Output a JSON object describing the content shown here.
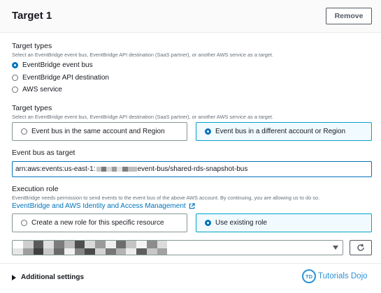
{
  "header": {
    "title": "Target 1",
    "remove_label": "Remove"
  },
  "target_types_1": {
    "label": "Target types",
    "description": "Select an EventBridge event bus, EventBridge API destination (SaaS partner), or another AWS service as a target.",
    "options": [
      {
        "label": "EventBridge event bus",
        "selected": true
      },
      {
        "label": "EventBridge API destination",
        "selected": false
      },
      {
        "label": "AWS service",
        "selected": false
      }
    ]
  },
  "target_types_2": {
    "label": "Target types",
    "description": "Select an EventBridge event bus, EventBridge API destination (SaaS partner), or another AWS service as a target.",
    "options": [
      {
        "label": "Event bus in the same account and Region",
        "selected": false
      },
      {
        "label": "Event bus in a different account or Region",
        "selected": true
      }
    ]
  },
  "event_bus_target": {
    "label": "Event bus as target",
    "value_prefix": "arn:aws:events:us-east-1:",
    "value_suffix": "event-bus/shared-rds-snapshot-bus"
  },
  "execution_role": {
    "label": "Execution role",
    "description": "EventBridge needs permission to send events to the event bus of the above AWS account. By continuing, you are allowing us to do so.",
    "link_text": "EventBridge and AWS Identity and Access Management",
    "options": [
      {
        "label": "Create a new role for this specific resource",
        "selected": false
      },
      {
        "label": "Use existing role",
        "selected": true
      }
    ]
  },
  "additional_settings": {
    "label": "Additional settings"
  },
  "watermark": {
    "badge": "TD",
    "text": "Tutorials Dojo"
  },
  "colors": {
    "accent": "#0073bb",
    "selected_tile_bg": "#f1faff",
    "selected_tile_border": "#00a1c9",
    "watermark": "#2b93d6"
  },
  "icons": [
    "external-link-icon",
    "chevron-down-icon",
    "refresh-icon",
    "caret-right-icon"
  ]
}
